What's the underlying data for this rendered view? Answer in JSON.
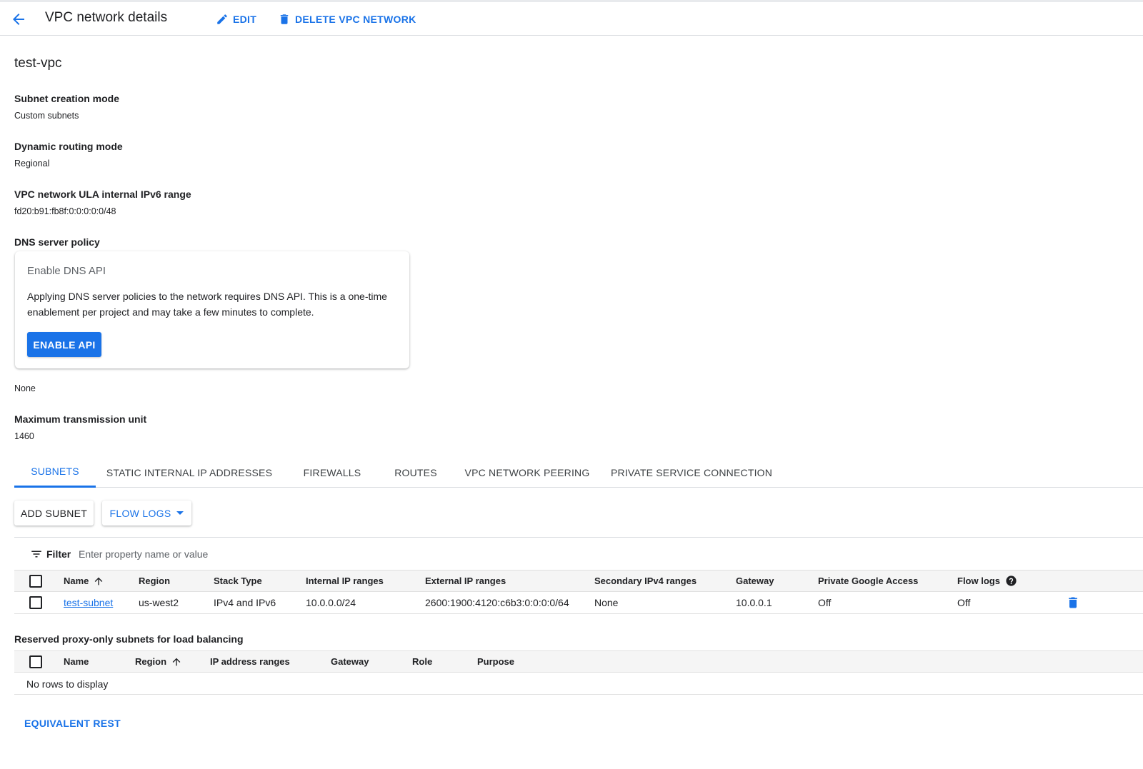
{
  "header": {
    "title": "VPC network details",
    "edit_label": "EDIT",
    "delete_label": "DELETE VPC NETWORK"
  },
  "network": {
    "name": "test-vpc",
    "subnet_mode_label": "Subnet creation mode",
    "subnet_mode_value": "Custom subnets",
    "routing_label": "Dynamic routing mode",
    "routing_value": "Regional",
    "ipv6_label": "VPC network ULA internal IPv6 range",
    "ipv6_value": "fd20:b91:fb8f:0:0:0:0:0/48",
    "dns_label": "DNS server policy",
    "dns_value": "None",
    "mtu_label": "Maximum transmission unit",
    "mtu_value": "1460"
  },
  "dns_card": {
    "title": "Enable DNS API",
    "text": "Applying DNS server policies to the network requires DNS API. This is a one-time enablement per project and may take a few minutes to complete.",
    "button": "ENABLE API"
  },
  "tabs": [
    {
      "label": "SUBNETS",
      "active": true
    },
    {
      "label": "STATIC INTERNAL IP ADDRESSES"
    },
    {
      "label": "FIREWALLS"
    },
    {
      "label": "ROUTES"
    },
    {
      "label": "VPC NETWORK PEERING"
    },
    {
      "label": "PRIVATE SERVICE CONNECTION"
    }
  ],
  "actions": {
    "add_subnet": "ADD SUBNET",
    "flow_logs": "FLOW LOGS"
  },
  "filter": {
    "label": "Filter",
    "placeholder": "Enter property name or value"
  },
  "subnets_table": {
    "columns": [
      "Name",
      "Region",
      "Stack Type",
      "Internal IP ranges",
      "External IP ranges",
      "Secondary IPv4 ranges",
      "Gateway",
      "Private Google Access",
      "Flow logs"
    ],
    "rows": [
      [
        "test-subnet",
        "us-west2",
        "IPv4 and IPv6",
        "10.0.0.0/24",
        "2600:1900:4120:c6b3:0:0:0:0/64",
        "None",
        "10.0.0.1",
        "Off",
        "Off"
      ]
    ]
  },
  "proxy_section": {
    "title": "Reserved proxy-only subnets for load balancing",
    "columns": [
      "Name",
      "Region",
      "IP address ranges",
      "Gateway",
      "Role",
      "Purpose"
    ],
    "empty_text": "No rows to display"
  },
  "footer": {
    "rest_link": "EQUIVALENT REST"
  },
  "colors": {
    "accent": "#1a73e8",
    "text": "#202124",
    "header_bg": "#f5f5f5"
  }
}
